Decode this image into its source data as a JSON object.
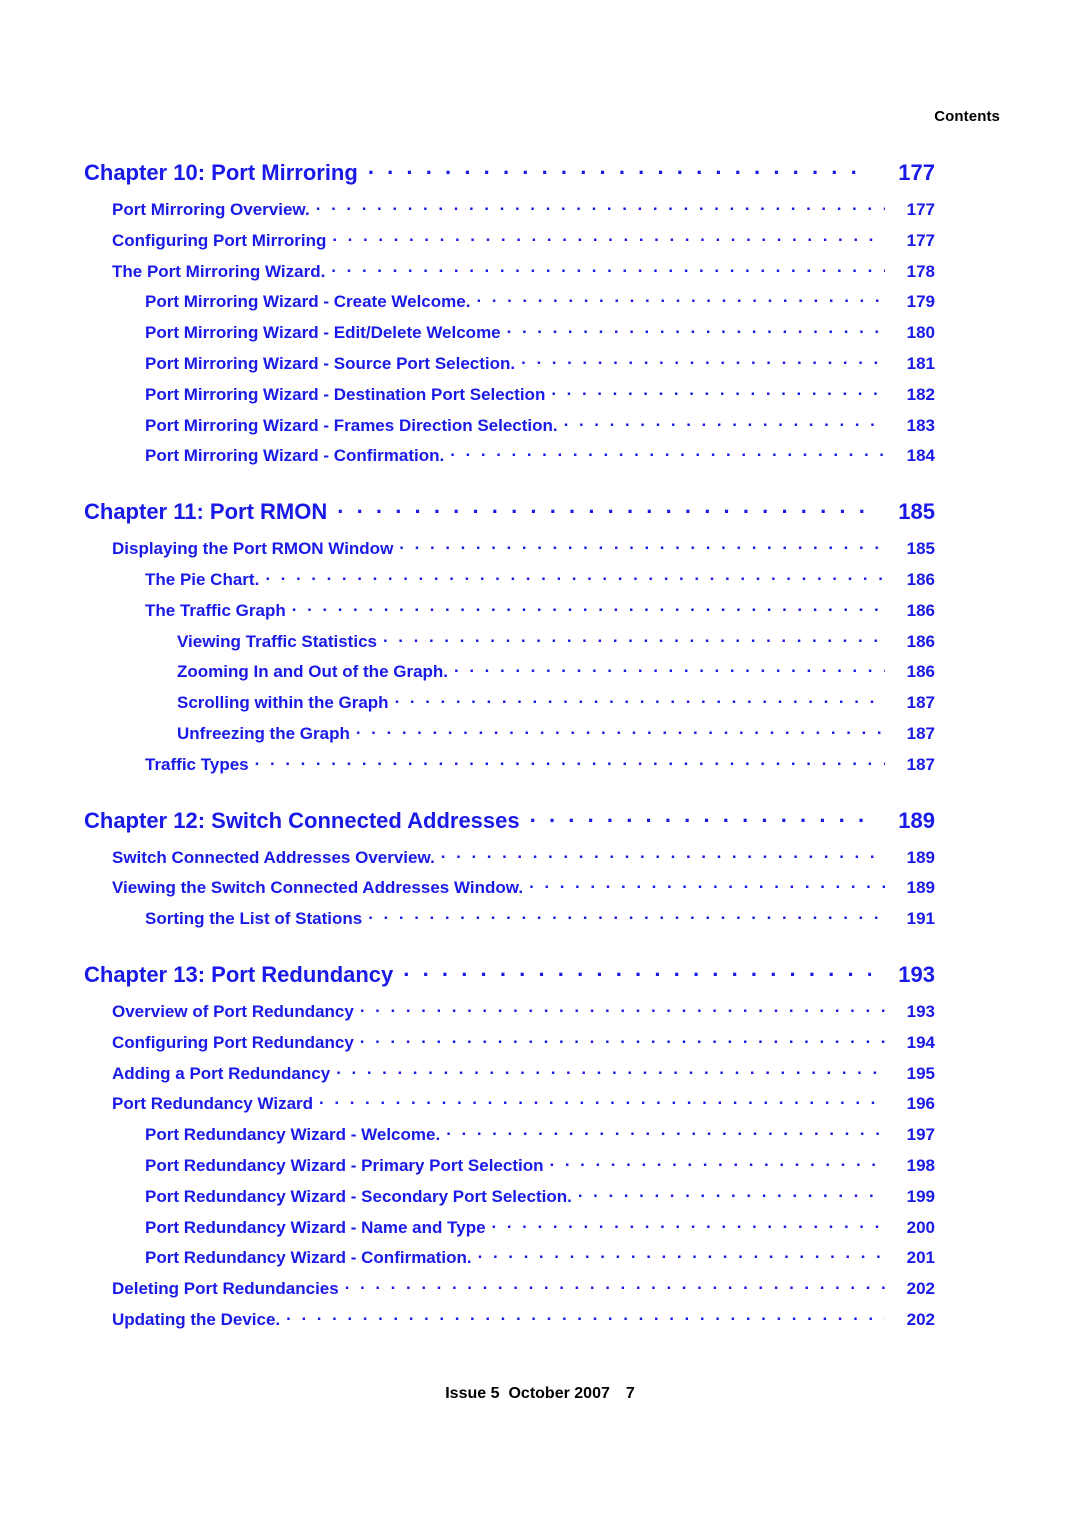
{
  "header": {
    "running_head": "Contents"
  },
  "colors": {
    "link_blue": "#1a1ae8",
    "text_black": "#000000",
    "page_background": "#ffffff"
  },
  "toc": {
    "leader_char": ".",
    "entries": [
      {
        "level": 1,
        "title": "Chapter 10: Port Mirroring",
        "page": "177"
      },
      {
        "level": 2,
        "title": "Port Mirroring Overview.",
        "page": "177"
      },
      {
        "level": 2,
        "title": "Configuring Port Mirroring",
        "page": "177"
      },
      {
        "level": 2,
        "title": "The Port Mirroring Wizard.",
        "page": "178"
      },
      {
        "level": 3,
        "title": "Port Mirroring Wizard - Create Welcome.",
        "page": "179"
      },
      {
        "level": 3,
        "title": "Port Mirroring Wizard - Edit/Delete Welcome",
        "page": "180"
      },
      {
        "level": 3,
        "title": "Port Mirroring Wizard - Source Port Selection.",
        "page": "181"
      },
      {
        "level": 3,
        "title": "Port Mirroring Wizard - Destination Port Selection",
        "page": "182"
      },
      {
        "level": 3,
        "title": "Port Mirroring Wizard - Frames Direction Selection.",
        "page": "183"
      },
      {
        "level": 3,
        "title": "Port Mirroring Wizard - Confirmation.",
        "page": "184"
      },
      {
        "level": 1,
        "title": "Chapter 11: Port RMON",
        "page": "185"
      },
      {
        "level": 2,
        "title": "Displaying the Port RMON Window",
        "page": "185"
      },
      {
        "level": 3,
        "title": "The Pie Chart.",
        "page": "186"
      },
      {
        "level": 3,
        "title": "The Traffic Graph",
        "page": "186"
      },
      {
        "level": 4,
        "title": "Viewing Traffic Statistics",
        "page": "186"
      },
      {
        "level": 4,
        "title": "Zooming In and Out of the Graph.",
        "page": "186"
      },
      {
        "level": 4,
        "title": "Scrolling within the Graph",
        "page": "187"
      },
      {
        "level": 4,
        "title": "Unfreezing the Graph",
        "page": "187"
      },
      {
        "level": 3,
        "title": "Traffic Types",
        "page": "187"
      },
      {
        "level": 1,
        "title": "Chapter 12: Switch Connected Addresses",
        "page": "189"
      },
      {
        "level": 2,
        "title": "Switch Connected Addresses Overview.",
        "page": "189"
      },
      {
        "level": 2,
        "title": "Viewing the Switch Connected Addresses Window.",
        "page": "189"
      },
      {
        "level": 3,
        "title": "Sorting the List of Stations",
        "page": "191"
      },
      {
        "level": 1,
        "title": "Chapter 13: Port Redundancy",
        "page": "193"
      },
      {
        "level": 2,
        "title": "Overview of Port Redundancy",
        "page": "193"
      },
      {
        "level": 2,
        "title": "Configuring Port Redundancy",
        "page": "194"
      },
      {
        "level": 2,
        "title": "Adding a Port Redundancy",
        "page": "195"
      },
      {
        "level": 2,
        "title": "Port Redundancy Wizard",
        "page": "196"
      },
      {
        "level": 3,
        "title": "Port Redundancy Wizard - Welcome.",
        "page": "197"
      },
      {
        "level": 3,
        "title": "Port Redundancy Wizard - Primary Port Selection",
        "page": "198"
      },
      {
        "level": 3,
        "title": "Port Redundancy Wizard - Secondary Port Selection.",
        "page": "199"
      },
      {
        "level": 3,
        "title": "Port Redundancy Wizard - Name and Type",
        "page": "200"
      },
      {
        "level": 3,
        "title": "Port Redundancy Wizard - Confirmation.",
        "page": "201"
      },
      {
        "level": 2,
        "title": "Deleting Port Redundancies",
        "page": "202"
      },
      {
        "level": 2,
        "title": "Updating the Device.",
        "page": "202"
      }
    ]
  },
  "footer": {
    "issue": "Issue 5",
    "date": "October 2007",
    "page_number": "7"
  }
}
